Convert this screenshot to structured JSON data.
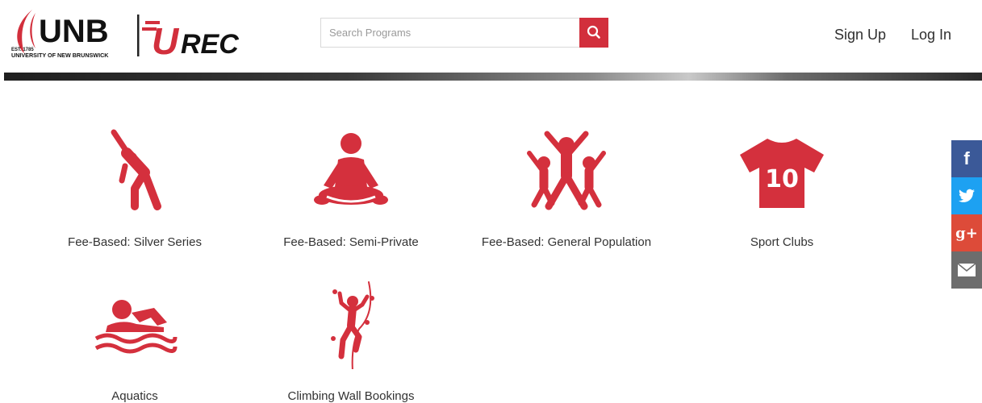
{
  "brand": {
    "university_abbr": "UNB",
    "established": "EST. 1785",
    "university_name": "UNIVERSITY OF NEW BRUNSWICK",
    "dept_logo_letter": "U",
    "dept_logo_text": "REC"
  },
  "search": {
    "placeholder": "Search Programs",
    "icon": "search-icon"
  },
  "nav": {
    "signup": "Sign Up",
    "login": "Log In"
  },
  "programs": [
    {
      "label": "Fee-Based: Silver Series",
      "icon": "stretching-person-icon"
    },
    {
      "label": "Fee-Based: Semi-Private",
      "icon": "meditation-icon"
    },
    {
      "label": "Fee-Based: General Population",
      "icon": "group-jumping-icon"
    },
    {
      "label": "Sport Clubs",
      "icon": "jersey-icon",
      "jersey_number": "10"
    },
    {
      "label": "Aquatics",
      "icon": "swimmer-icon"
    },
    {
      "label": "Climbing Wall Bookings",
      "icon": "climber-icon"
    }
  ],
  "social": [
    {
      "name": "facebook",
      "glyph": "f",
      "color": "#3b5998"
    },
    {
      "name": "twitter",
      "glyph": "",
      "color": "#1da1f2"
    },
    {
      "name": "google-plus",
      "glyph": "g+",
      "color": "#dd4b39"
    },
    {
      "name": "email",
      "glyph": "",
      "color": "#6d6d6d"
    }
  ],
  "colors": {
    "accent": "#d22f3c",
    "icon_red": "#d4303d"
  }
}
